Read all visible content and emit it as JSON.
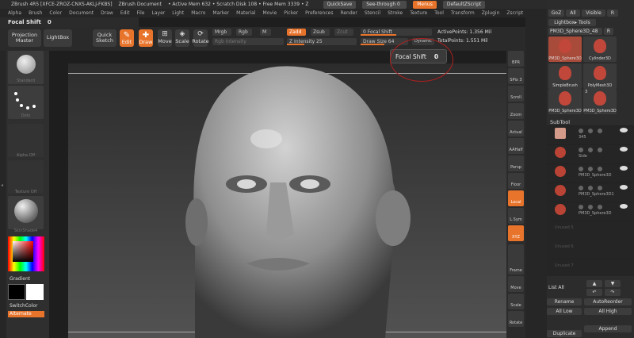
{
  "titlebar": {
    "app": "ZBrush 4R5 [XFCE-ZROZ-CNXS-AKLJ-FKBS]",
    "doc": "ZBrush Document",
    "mem": "• Active Mem 632 • Scratch Disk 108 • Free Mem 3339 • Z",
    "quicksave": "QuickSave",
    "seethrough": "See-through 0",
    "menus": "Menus",
    "defaultscript": "DefaultZScript"
  },
  "menubar": [
    "Alpha",
    "Brush",
    "Color",
    "Document",
    "Draw",
    "Edit",
    "File",
    "Layer",
    "Light",
    "Macro",
    "Marker",
    "Material",
    "Movie",
    "Picker",
    "Preferences",
    "Render",
    "Stencil",
    "Stroke",
    "Texture",
    "Tool",
    "Transform",
    "Zplugin",
    "Zscript"
  ],
  "focalrow": {
    "label": "Focal Shift",
    "value": "0"
  },
  "toolbar": {
    "projection_master": "Projection Master",
    "lightbox": "LightBox",
    "quick_sketch": "Quick Sketch",
    "edit": "Edit",
    "draw": "Draw",
    "move": "Move",
    "scale": "Scale",
    "rotate": "Rotate",
    "mrgb": "Mrgb",
    "rgb": "Rgb",
    "m": "M",
    "rgb_intensity": "Rgb Intensity",
    "zadd": "Zadd",
    "zsub": "Zsub",
    "zcut": "Zcut",
    "z_intensity": "Z Intensity 25",
    "focal_shift": "0 Focal Shift",
    "draw_size": "Draw Size 64",
    "dynamic": "Dynamic",
    "active_points": "ActivePoints: 1.356 Mil",
    "total_points": "TotalPoints: 1.551 Mil"
  },
  "tooltip": {
    "label": "Focal Shift",
    "value": "0"
  },
  "lefttray": {
    "brush_label": "Standard",
    "stroke_label": "Dots",
    "alpha_label": "Alpha Off",
    "texture_label": "Texture Off",
    "material_label": "SkinShade4",
    "gradient": "Gradient",
    "switchcolor": "SwitchColor",
    "alternate": "Alternate"
  },
  "viewbar": [
    "BPR",
    "SPix 3",
    "Scroll",
    "Zoom",
    "Actual",
    "AAHalf",
    "Persp",
    "Floor",
    "Local",
    "L.Sym",
    "XYZ",
    "",
    "Frame",
    "Move",
    "Scale",
    "Rotate"
  ],
  "rightpanel": {
    "goz": "GoZ",
    "all": "All",
    "visible": "Visible",
    "r": "R",
    "lightbox_tools": "Lightbox▸ Tools",
    "tool_name": "PM3D_Sphere3D_48",
    "tool_r": "R",
    "thumbs": [
      {
        "num": "",
        "label": "PM3D_Sphere3D"
      },
      {
        "num": "",
        "label": "Cylinder3D"
      },
      {
        "num": "",
        "label": "SimpleBrush"
      },
      {
        "num": "",
        "label": "PolyMesh3D"
      },
      {
        "num": "",
        "label": "PM3D_Sphere3D"
      },
      {
        "num": "3",
        "label": "PM3D_Sphere3D"
      }
    ],
    "subtool": "SubTool",
    "subtools": [
      "345",
      "Side",
      "PM3D_Sphere3D",
      "PM3D_Sphere3D1",
      "PM3D_Sphere3D",
      "Unused 5",
      "Unused 6",
      "Unused 7"
    ],
    "list_all": "List All",
    "rename": "Rename",
    "autoreorder": "AutoReorder",
    "all_low": "All Low",
    "all_high": "All High",
    "append": "Append",
    "duplicate": "Duplicate"
  },
  "colors": {
    "accent": "#e8742c",
    "panel": "#2c2c2c"
  }
}
